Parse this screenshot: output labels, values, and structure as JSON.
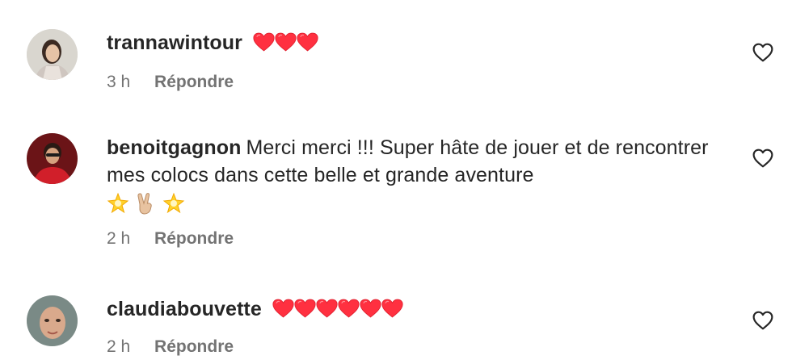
{
  "comments": [
    {
      "username": "trannawintour",
      "text": "",
      "hearts": 3,
      "time": "3 h",
      "reply_label": "Répondre"
    },
    {
      "username": "benoitgagnon",
      "text": "Merci merci !!! Super hâte de jouer et de rencontrer mes colocs dans cette belle et grande aventure",
      "emojis": [
        "glowing-star",
        "victory-hand",
        "glowing-star"
      ],
      "time": "2 h",
      "reply_label": "Répondre"
    },
    {
      "username": "claudiabouvette",
      "text": "",
      "hearts": 6,
      "time": "2 h",
      "reply_label": "Répondre"
    }
  ],
  "colors": {
    "heart": "#ff3040",
    "secondary_text": "#737373",
    "primary_text": "#262626"
  },
  "icons": [
    "heart-outline-icon",
    "red-heart-emoji",
    "glowing-star-emoji",
    "victory-hand-emoji"
  ]
}
